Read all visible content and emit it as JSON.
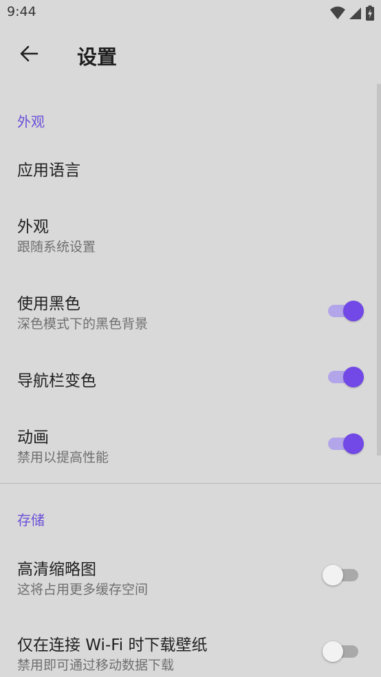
{
  "status_bar": {
    "time": "9:44",
    "icons": [
      "wifi-icon",
      "cell-signal-icon",
      "battery-charging-icon"
    ]
  },
  "app_bar": {
    "back_icon": "arrow-left-icon",
    "title": "设置"
  },
  "sections": [
    {
      "header": "外观",
      "items": [
        {
          "title": "应用语言",
          "summary": null,
          "switch": null
        },
        {
          "title": "外观",
          "summary": "跟随系统设置",
          "switch": null
        },
        {
          "title": "使用黑色",
          "summary": "深色模式下的黑色背景",
          "switch": true
        },
        {
          "title": "导航栏变色",
          "summary": null,
          "switch": true
        },
        {
          "title": "动画",
          "summary": "禁用以提高性能",
          "switch": true
        }
      ]
    },
    {
      "header": "存储",
      "items": [
        {
          "title": "高清缩略图",
          "summary": "这将占用更多缓存空间",
          "switch": false
        },
        {
          "title": "仅在连接 Wi-Fi 时下载壁纸",
          "summary": "禁用即可通过移动数据下载",
          "switch": false
        }
      ]
    }
  ],
  "colors": {
    "background": "#d9d9d9",
    "accent": "#7248e6",
    "section_header": "#6a4fd8",
    "switch_track_on": "#b3a5e9",
    "switch_track_off": "#a9a9a9"
  }
}
